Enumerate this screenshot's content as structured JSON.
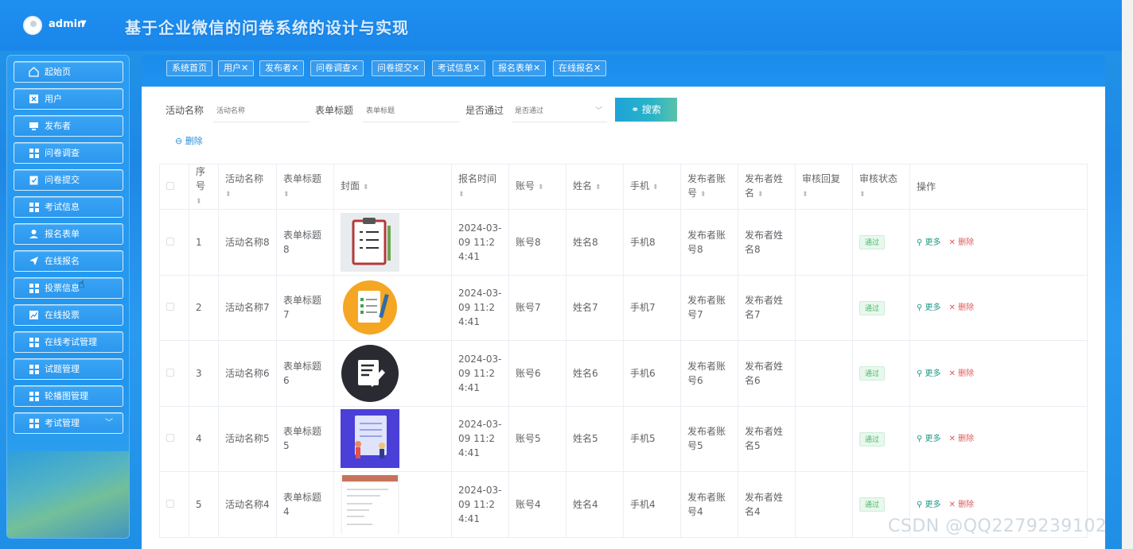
{
  "header": {
    "user": "admin",
    "title": "基于企业微信的问卷系统的设计与实现"
  },
  "sidebar": {
    "items": [
      {
        "label": "起始页",
        "icon": "home-icon"
      },
      {
        "label": "用户",
        "icon": "user-card-icon"
      },
      {
        "label": "发布者",
        "icon": "monitor-icon"
      },
      {
        "label": "问卷调查",
        "icon": "grid-icon"
      },
      {
        "label": "问卷提交",
        "icon": "clipboard-check-icon"
      },
      {
        "label": "考试信息",
        "icon": "grid-icon"
      },
      {
        "label": "报名表单",
        "icon": "person-icon"
      },
      {
        "label": "在线报名",
        "icon": "paper-plane-icon"
      },
      {
        "label": "投票信息",
        "icon": "grid-icon"
      },
      {
        "label": "在线投票",
        "icon": "chart-line-icon"
      },
      {
        "label": "在线考试管理",
        "icon": "grid-icon"
      },
      {
        "label": "试题管理",
        "icon": "grid-icon"
      },
      {
        "label": "轮播图管理",
        "icon": "grid-icon"
      },
      {
        "label": "考试管理",
        "icon": "grid-icon"
      }
    ]
  },
  "tabs": [
    {
      "label": "系统首页",
      "closable": false
    },
    {
      "label": "用户",
      "closable": true
    },
    {
      "label": "发布者",
      "closable": true
    },
    {
      "label": "问卷调查",
      "closable": true
    },
    {
      "label": "问卷提交",
      "closable": true
    },
    {
      "label": "考试信息",
      "closable": true
    },
    {
      "label": "报名表单",
      "closable": true
    },
    {
      "label": "在线报名",
      "closable": true
    }
  ],
  "filters": {
    "activity_label": "活动名称",
    "activity_placeholder": "活动名称",
    "form_label": "表单标题",
    "form_placeholder": "表单标题",
    "pass_label": "是否通过",
    "pass_placeholder": "是否通过",
    "search_label": "搜索",
    "delete_label": "删除"
  },
  "table": {
    "headers": {
      "index": "序号",
      "activity": "活动名称",
      "form": "表单标题",
      "cover": "封面",
      "time": "报名时间",
      "account": "账号",
      "name": "姓名",
      "phone": "手机",
      "pub_account": "发布者账号",
      "pub_name": "发布者姓名",
      "review_reply": "审核回复",
      "review_status": "审核状态",
      "ops": "操作"
    },
    "rows": [
      {
        "index": "1",
        "activity": "活动名称8",
        "form": "表单标题8",
        "cover": "clipboard-checklist-image",
        "time": "2024-03-09 11:24:41",
        "account": "账号8",
        "name": "姓名8",
        "phone": "手机8",
        "pub_account": "发布者账号8",
        "pub_name": "发布者姓名8",
        "review_reply": "",
        "status": "通过",
        "more": "更多",
        "delete": "删除"
      },
      {
        "index": "2",
        "activity": "活动名称7",
        "form": "表单标题7",
        "cover": "orange-document-image",
        "time": "2024-03-09 11:24:41",
        "account": "账号7",
        "name": "姓名7",
        "phone": "手机7",
        "pub_account": "发布者账号7",
        "pub_name": "发布者姓名7",
        "review_reply": "",
        "status": "通过",
        "more": "更多",
        "delete": "删除"
      },
      {
        "index": "3",
        "activity": "活动名称6",
        "form": "表单标题6",
        "cover": "dark-edit-image",
        "time": "2024-03-09 11:24:41",
        "account": "账号6",
        "name": "姓名6",
        "phone": "手机6",
        "pub_account": "发布者账号6",
        "pub_name": "发布者姓名6",
        "review_reply": "",
        "status": "通过",
        "more": "更多",
        "delete": "删除"
      },
      {
        "index": "4",
        "activity": "活动名称5",
        "form": "表单标题5",
        "cover": "purple-illustration-image",
        "time": "2024-03-09 11:24:41",
        "account": "账号5",
        "name": "姓名5",
        "phone": "手机5",
        "pub_account": "发布者账号5",
        "pub_name": "发布者姓名5",
        "review_reply": "",
        "status": "通过",
        "more": "更多",
        "delete": "删除"
      },
      {
        "index": "5",
        "activity": "活动名称4",
        "form": "表单标题4",
        "cover": "form-document-image",
        "time": "2024-03-09 11:24:41",
        "account": "账号4",
        "name": "姓名4",
        "phone": "手机4",
        "pub_account": "发布者账号4",
        "pub_name": "发布者姓名4",
        "review_reply": "",
        "status": "通过",
        "more": "更多",
        "delete": "删除"
      }
    ]
  },
  "watermark": "CSDN @QQ2279239102",
  "colors": {
    "brand_blue": "#1e8ff0",
    "status_green": "#48b86a",
    "delete_red": "#e0585a"
  }
}
